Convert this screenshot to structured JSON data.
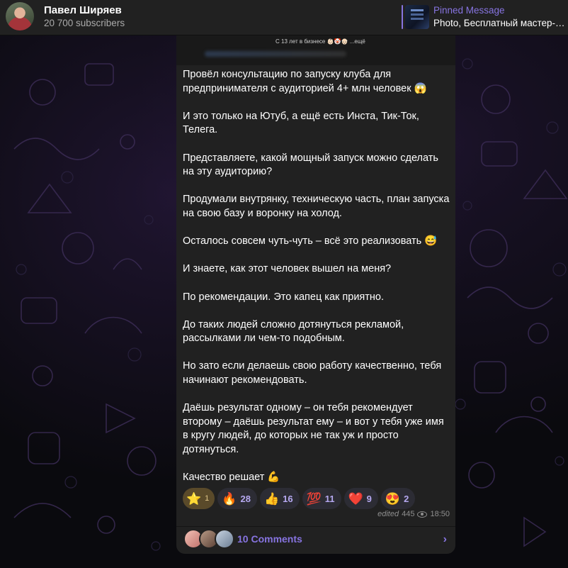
{
  "header": {
    "channel_name": "Павел Ширяев",
    "subscribers": "20 700 subscribers",
    "pinned": {
      "title": "Pinned Message",
      "text": "Photo, Бесплатный мастер-к..."
    }
  },
  "message": {
    "media_caption": "С 13 лет в бизнесе 👶🏻🤡👴🏻 ...ещё",
    "text": "Провёл консультацию по запуску клуба для предпринимателя с аудиторией 4+ млн человек 😱\n\nИ это только на Ютуб, а ещё есть Инста, Тик-Ток, Телега.\n\nПредставляете, какой мощный запуск можно сделать на эту аудиторию?\n\nПродумали внутрянку, техническую часть, план запуска на свою базу и воронку на холод.\n\nОсталось совсем чуть-чуть – всё это реализовать 😅\n\nИ знаете, как этот человек вышел на меня?\n\nПо рекомендации. Это капец как приятно.\n\nДо таких людей сложно дотянуться рекламой, рассылками ли чем-то подобным.\n\nНо зато если делаешь свою работу качественно, тебя начинают рекомендовать.\n\nДаёшь результат одному – он тебя рекомендует второму – даёшь результат ему – и вот у тебя уже имя в кругу людей, до которых не так уж и просто дотянуться.\n\nКачество решает 💪",
    "reactions": [
      {
        "emoji": "⭐",
        "count": "1"
      },
      {
        "emoji": "🔥",
        "count": "28"
      },
      {
        "emoji": "👍",
        "count": "16"
      },
      {
        "emoji": "💯",
        "count": "11"
      },
      {
        "emoji": "❤️",
        "count": "9"
      },
      {
        "emoji": "😍",
        "count": "2"
      }
    ],
    "edited_label": "edited",
    "views": "445",
    "time": "18:50",
    "comments_label": "10 Comments",
    "comments_arrow": "›"
  },
  "colors": {
    "accent": "#8774e1",
    "header_bg": "#212121",
    "bubble_bg": "#212121"
  }
}
